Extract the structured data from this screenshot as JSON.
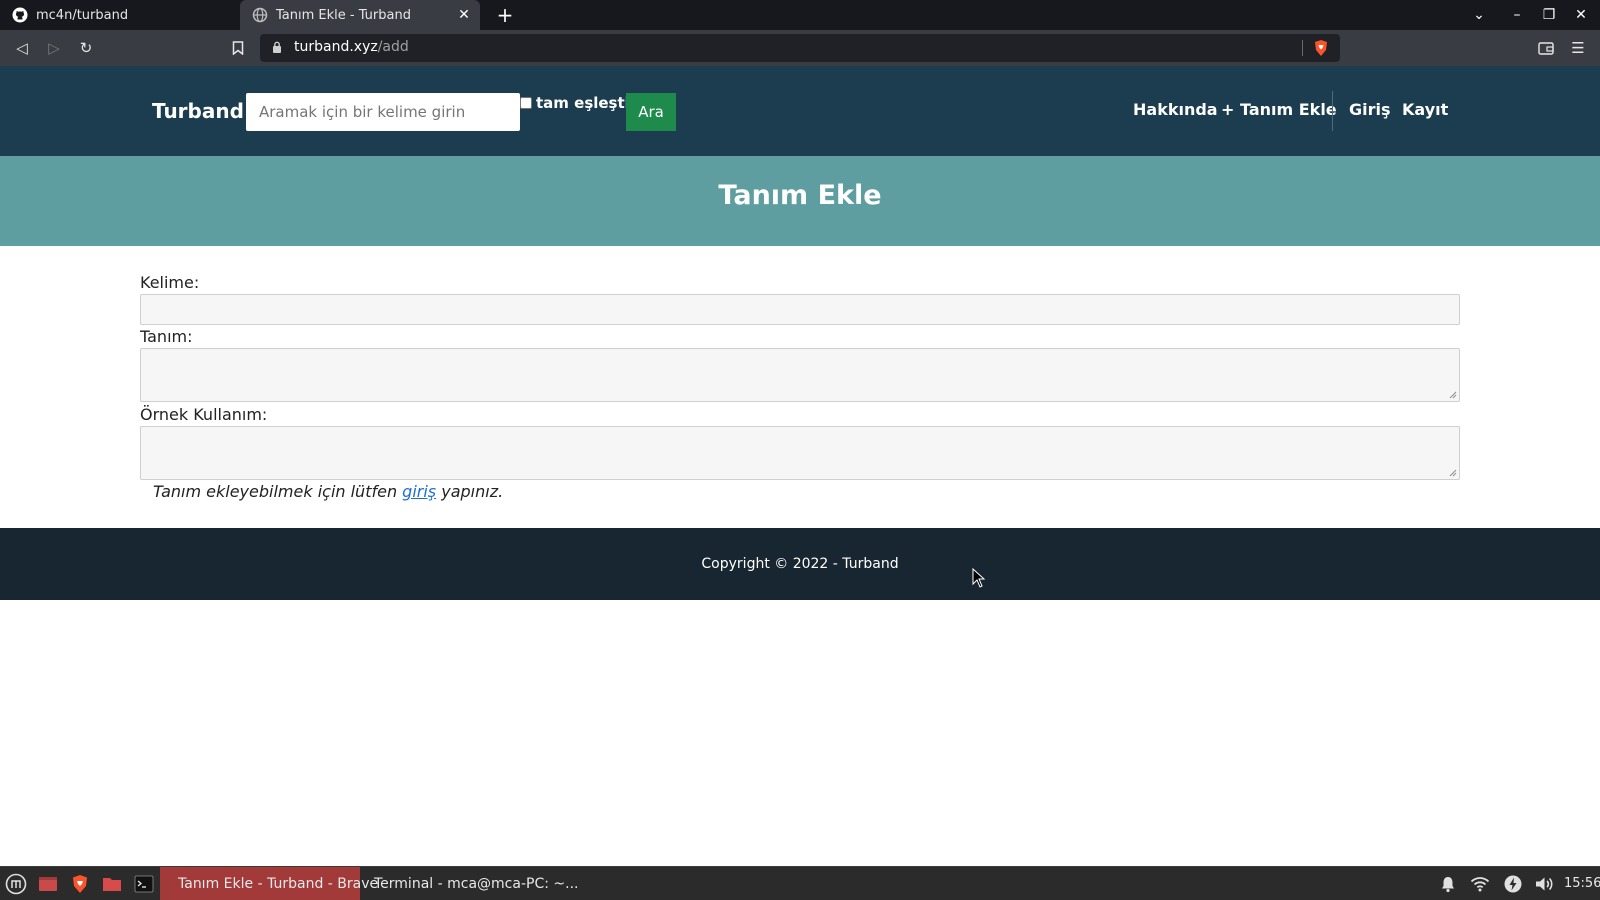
{
  "browser": {
    "tabs": [
      {
        "title": "mc4n/turband",
        "icon": "github-icon"
      },
      {
        "title": "Tanım Ekle - Turband",
        "icon": "globe-icon",
        "active": true
      }
    ],
    "url_host": "turband.xyz",
    "url_path": "/add"
  },
  "header": {
    "brand": "Turband",
    "search_placeholder": "Aramak için bir kelime girin",
    "exact_match_label": "tam eşleştir",
    "search_button": "Ara",
    "nav": {
      "about": "Hakkında",
      "add_definition": "+ Tanım Ekle",
      "login": "Giriş",
      "register": "Kayıt"
    }
  },
  "banner": {
    "title": "Tanım Ekle"
  },
  "form": {
    "word_label": "Kelime:",
    "definition_label": "Tanım:",
    "example_label": "Örnek Kullanım:",
    "note_before": "Tanım ekleyebilmek için lütfen ",
    "note_link": "giriş",
    "note_after": " yapınız."
  },
  "footer": {
    "text": "Copyright © 2022 - Turband"
  },
  "taskbar": {
    "windows": [
      {
        "title": "Tanım Ekle - Turband - Brave",
        "active": true
      },
      {
        "title": "Terminal - mca@mca-PC: ~..."
      }
    ],
    "clock": "15:56"
  },
  "colors": {
    "header_bg": "#1c3c4f",
    "banner_bg": "#5f9ea0",
    "search_button_bg": "#1e8a4c",
    "footer_bg": "#182632",
    "link": "#1a6fd6"
  }
}
